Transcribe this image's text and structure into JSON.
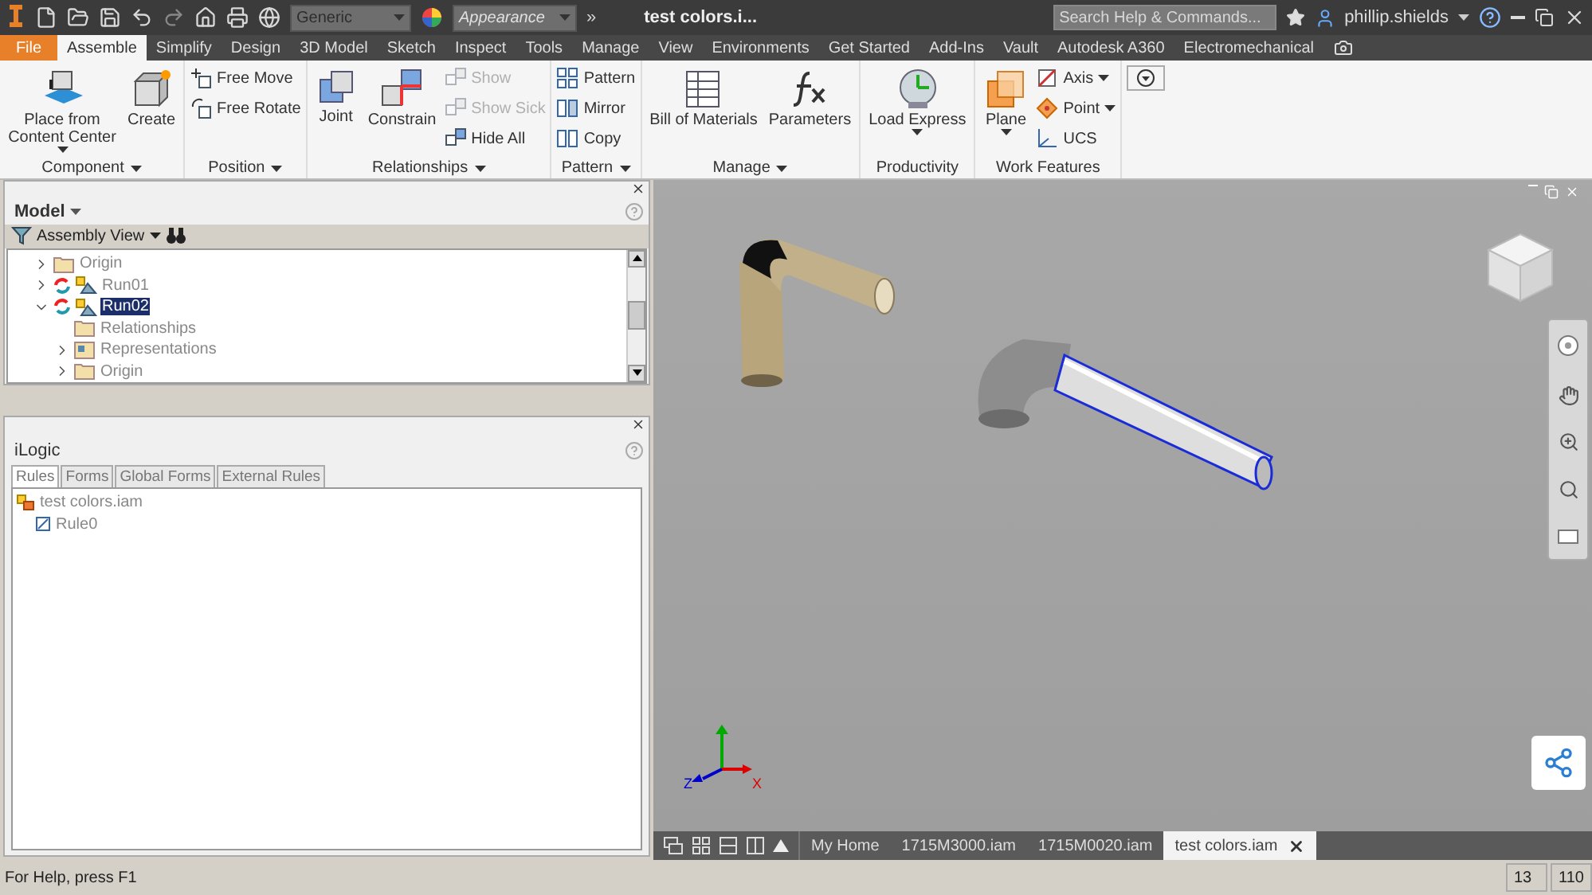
{
  "app_bar": {
    "style_value": "Generic",
    "appearance_placeholder": "Appearance",
    "overflow": "»",
    "title": "test colors.i...",
    "search_placeholder": "Search Help & Commands...",
    "user": "phillip.shields"
  },
  "tabs": [
    {
      "label": "File",
      "kind": "file",
      "selected": false
    },
    {
      "label": "Assemble",
      "kind": "tab",
      "selected": true
    },
    {
      "label": "Simplify",
      "kind": "tab",
      "selected": false
    },
    {
      "label": "Design",
      "kind": "tab",
      "selected": false
    },
    {
      "label": "3D Model",
      "kind": "tab",
      "selected": false
    },
    {
      "label": "Sketch",
      "kind": "tab",
      "selected": false
    },
    {
      "label": "Inspect",
      "kind": "tab",
      "selected": false
    },
    {
      "label": "Tools",
      "kind": "tab",
      "selected": false
    },
    {
      "label": "Manage",
      "kind": "tab",
      "selected": false
    },
    {
      "label": "View",
      "kind": "tab",
      "selected": false
    },
    {
      "label": "Environments",
      "kind": "tab",
      "selected": false
    },
    {
      "label": "Get Started",
      "kind": "tab",
      "selected": false
    },
    {
      "label": "Add-Ins",
      "kind": "tab",
      "selected": false
    },
    {
      "label": "Vault",
      "kind": "tab",
      "selected": false
    },
    {
      "label": "Autodesk A360",
      "kind": "tab",
      "selected": false
    },
    {
      "label": "Electromechanical",
      "kind": "tab",
      "selected": false
    }
  ],
  "ribbon": [
    {
      "label": "Component",
      "has_menu": true,
      "tools": [
        {
          "label": "Place from Content Center",
          "kind": "large",
          "disabled": false,
          "has_menu": true
        },
        {
          "label": "Create",
          "kind": "large",
          "disabled": false,
          "has_menu": false
        }
      ]
    },
    {
      "label": "Position",
      "has_menu": true,
      "tools": [
        {
          "label": "Free Move",
          "kind": "small",
          "disabled": false,
          "has_menu": false
        },
        {
          "label": "Free Rotate",
          "kind": "small",
          "disabled": false,
          "has_menu": false
        }
      ]
    },
    {
      "label": "Relationships",
      "has_menu": true,
      "tools": [
        {
          "label": "Joint",
          "kind": "large",
          "disabled": false,
          "has_menu": false
        },
        {
          "label": "Constrain",
          "kind": "large",
          "disabled": false,
          "has_menu": false
        },
        {
          "label": "Show",
          "kind": "small",
          "disabled": true,
          "has_menu": false
        },
        {
          "label": "Show Sick",
          "kind": "small",
          "disabled": true,
          "has_menu": false
        },
        {
          "label": "Hide All",
          "kind": "small",
          "disabled": false,
          "has_menu": false
        }
      ]
    },
    {
      "label": "Pattern",
      "has_menu": true,
      "tools": [
        {
          "label": "Pattern",
          "kind": "small",
          "disabled": false,
          "has_menu": false
        },
        {
          "label": "Mirror",
          "kind": "small",
          "disabled": false,
          "has_menu": false
        },
        {
          "label": "Copy",
          "kind": "small",
          "disabled": false,
          "has_menu": false
        }
      ]
    },
    {
      "label": "Manage",
      "has_menu": true,
      "tools": [
        {
          "label": "Bill of Materials",
          "kind": "large",
          "disabled": false,
          "has_menu": false
        },
        {
          "label": "Parameters",
          "kind": "large",
          "disabled": false,
          "has_menu": false
        }
      ]
    },
    {
      "label": "Productivity",
      "has_menu": false,
      "tools": [
        {
          "label": "Load Express",
          "kind": "large",
          "disabled": false,
          "has_menu": true
        }
      ]
    },
    {
      "label": "Work Features",
      "has_menu": false,
      "tools": [
        {
          "label": "Plane",
          "kind": "large",
          "disabled": false,
          "has_menu": true
        },
        {
          "label": "Axis",
          "kind": "small",
          "disabled": false,
          "has_menu": true
        },
        {
          "label": "Point",
          "kind": "small",
          "disabled": false,
          "has_menu": true
        },
        {
          "label": "UCS",
          "kind": "small",
          "disabled": false,
          "has_menu": false
        }
      ]
    }
  ],
  "model_panel": {
    "title": "Model",
    "view": "Assembly View",
    "tree": [
      {
        "label": "Origin",
        "kind": "folder",
        "expanded": false,
        "selected": false
      },
      {
        "label": "Run01",
        "kind": "assembly",
        "expanded": false,
        "selected": false
      },
      {
        "label": "Run02",
        "kind": "assembly",
        "expanded": true,
        "selected": true,
        "children": [
          {
            "label": "Relationships",
            "kind": "folder",
            "selected": false
          },
          {
            "label": "Representations",
            "kind": "representations",
            "expanded": false,
            "selected": false
          },
          {
            "label": "Origin",
            "kind": "folder",
            "expanded": false,
            "selected": false
          }
        ]
      }
    ]
  },
  "ilogic_panel": {
    "title": "iLogic",
    "tabs": [
      {
        "label": "Rules",
        "selected": true
      },
      {
        "label": "Forms",
        "selected": false
      },
      {
        "label": "Global Forms",
        "selected": false
      },
      {
        "label": "External Rules",
        "selected": false
      }
    ],
    "tree": [
      {
        "label": "test colors.iam",
        "kind": "document",
        "children": [
          {
            "label": "Rule0",
            "kind": "rule"
          }
        ]
      }
    ]
  },
  "viewport": {
    "axis_labels": [
      "Z",
      "X"
    ]
  },
  "document_tabs": [
    {
      "label": "My Home",
      "selected": false
    },
    {
      "label": "1715M3000.iam",
      "selected": false
    },
    {
      "label": "1715M0020.iam",
      "selected": false
    },
    {
      "label": "test colors.iam",
      "selected": true
    }
  ],
  "status_bar": {
    "message": "For Help, press F1",
    "cells": [
      "13",
      "110"
    ]
  }
}
